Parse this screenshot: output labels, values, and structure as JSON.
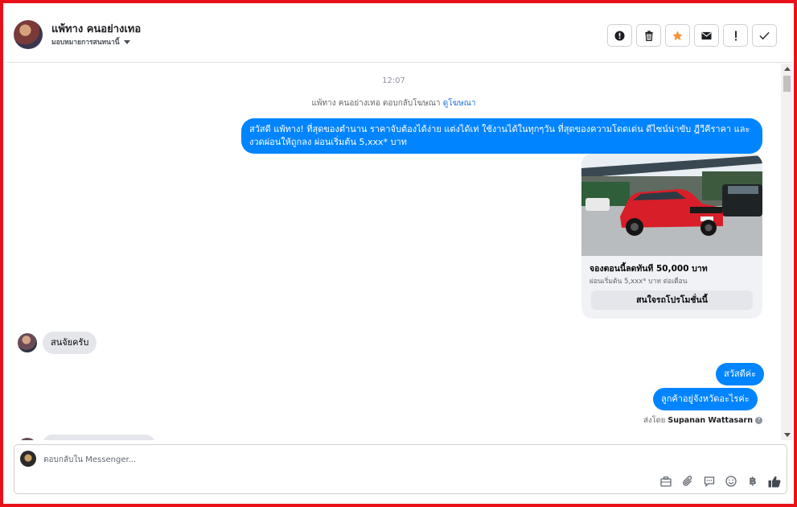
{
  "header": {
    "name": "แพ้ทาง คนอย่างเทอ",
    "assign_label": "มอบหมายการสนทนานี้",
    "actions": [
      {
        "icon": "alert-circle-icon",
        "label": "Mark as spam"
      },
      {
        "icon": "trash-icon",
        "label": "Delete"
      },
      {
        "icon": "star-icon",
        "label": "Star",
        "color": "#f7923b"
      },
      {
        "icon": "envelope-icon",
        "label": "Mark as unread"
      },
      {
        "icon": "exclamation-icon",
        "label": "Follow up"
      },
      {
        "icon": "check-icon",
        "label": "Done"
      }
    ]
  },
  "conversation": {
    "time": "12:07",
    "reply_note": "แพ้ทาง คนอย่างเทอ ตอบกลับโฆษณา",
    "reply_note_link": "ดูโฆษณา",
    "ad_message": "สวัสดี แพ้ทาง! ที่สุดของตำนาน ราคาจับต้องได้ง่าย แต่งได้เท่ ใช้งานได้ในทุกๆวัน ที่สุดของความโดดเด่น ดีไซน์น่าขับ ฎีวีคีราคา และงวดผ่อนให้ถูกลง ผ่อนเริ่มต้น 5,xxx* บาท",
    "card": {
      "title": "จองตอนนี้ลดทันที 50,000 บาท",
      "subtitle": "ผ่อนเริ่มต้น 5,xxx* บาท ต่อเดือน",
      "button": "สนใจรถโปรโมชั่นนี้"
    },
    "incoming_1": "สนจัยครับ",
    "outgoing_1": "สวัสดีค่ะ",
    "outgoing_2": "ลูกค้าอยู่จังหวัดอะไรค่ะ",
    "sent_by_prefix": "ส่งโดย",
    "sent_by_name": "Supanan Wattasarn"
  },
  "composer": {
    "placeholder": "ตอบกลับใน Messenger...",
    "tools": [
      "briefcase-icon",
      "paperclip-icon",
      "chat-bubble-icon",
      "smiley-icon",
      "baht-icon",
      "thumbs-up-icon"
    ]
  },
  "colors": {
    "accent": "#0084ff",
    "frame": "#e8111a",
    "star": "#f7923b"
  }
}
